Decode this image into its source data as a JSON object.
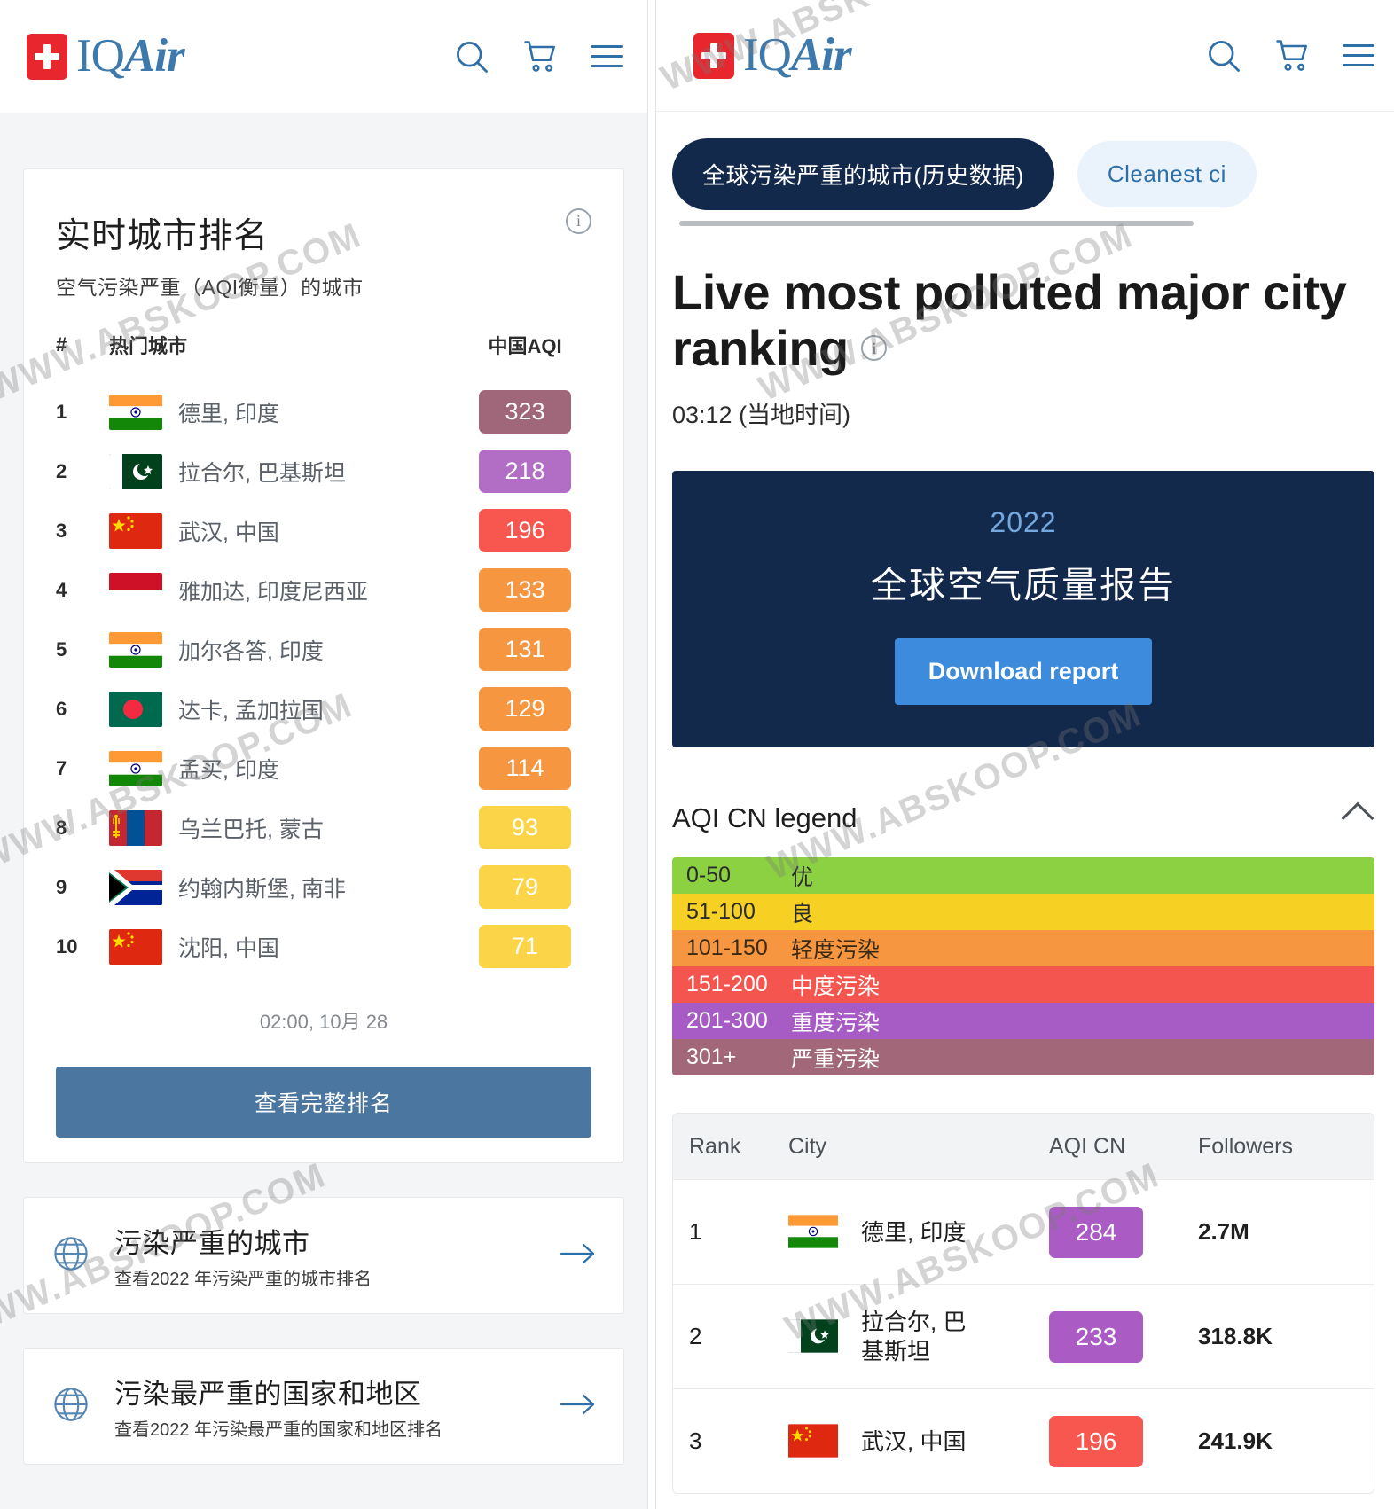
{
  "brand": {
    "name_iq": "IQ",
    "name_air": "Air",
    "accent": "#3e79ab",
    "flag_red": "#e8262d"
  },
  "header": {
    "search_icon": "search-icon",
    "cart_icon": "cart-icon",
    "menu_icon": "hamburger-menu-icon"
  },
  "left": {
    "card": {
      "title": "实时城市排名",
      "subtitle": "空气污染严重（AQI衡量）的城市",
      "info_glyph": "i",
      "columns": {
        "rank": "#",
        "city": "热门城市",
        "aqi": "中国AQI"
      },
      "rows": [
        {
          "rank": "1",
          "city": "德里, 印度",
          "aqi": "323",
          "color": "#a0667a",
          "flag": "in"
        },
        {
          "rank": "2",
          "city": "拉合尔, 巴基斯坦",
          "aqi": "218",
          "color": "#b26dc4",
          "flag": "pk"
        },
        {
          "rank": "3",
          "city": "武汉, 中国",
          "aqi": "196",
          "color": "#f8574f",
          "flag": "cn"
        },
        {
          "rank": "4",
          "city": "雅加达, 印度尼西亚",
          "aqi": "133",
          "color": "#f79640",
          "flag": "id"
        },
        {
          "rank": "5",
          "city": "加尔各答, 印度",
          "aqi": "131",
          "color": "#f79640",
          "flag": "in"
        },
        {
          "rank": "6",
          "city": "达卡, 孟加拉国",
          "aqi": "129",
          "color": "#f79640",
          "flag": "bd"
        },
        {
          "rank": "7",
          "city": "孟买, 印度",
          "aqi": "114",
          "color": "#f79640",
          "flag": "in"
        },
        {
          "rank": "8",
          "city": "乌兰巴托, 蒙古",
          "aqi": "93",
          "color": "#fbd448",
          "flag": "mn"
        },
        {
          "rank": "9",
          "city": "约翰内斯堡, 南非",
          "aqi": "79",
          "color": "#fbd448",
          "flag": "za"
        },
        {
          "rank": "10",
          "city": "沈阳, 中国",
          "aqi": "71",
          "color": "#fbd448",
          "flag": "cn"
        }
      ],
      "timestamp": "02:00, 10月 28",
      "full_ranking_button": "查看完整排名"
    },
    "links": [
      {
        "title": "污染严重的城市",
        "subtitle": "查看2022 年污染严重的城市排名",
        "icon": "globe-icon",
        "arrow": "arrow-right-icon"
      },
      {
        "title": "污染最严重的国家和地区",
        "subtitle": "查看2022 年污染最严重的国家和地区排名",
        "icon": "globe-icon",
        "arrow": "arrow-right-icon"
      }
    ]
  },
  "right": {
    "tabs": [
      {
        "label": "全球污染严重的城市(历史数据)",
        "active": true
      },
      {
        "label": "Cleanest ci",
        "active": false
      }
    ],
    "heading": "Live most polluted major city ranking",
    "heading_info_glyph": "i",
    "local_time": "03:12 (当地时间)",
    "report": {
      "year": "2022",
      "title": "全球空气质量报告",
      "button": "Download report"
    },
    "legend": {
      "title": "AQI CN legend",
      "collapse_icon": "chevron-up-icon",
      "rows": [
        {
          "range": "0-50",
          "label": "优",
          "bg": "#8bd142",
          "fg": "#2b2b2b"
        },
        {
          "range": "51-100",
          "label": "良",
          "bg": "#f7d024",
          "fg": "#2b2b2b"
        },
        {
          "range": "101-150",
          "label": "轻度污染",
          "bg": "#f79640",
          "fg": "#3a2a14"
        },
        {
          "range": "151-200",
          "label": "中度污染",
          "bg": "#f4564f",
          "fg": "#ffffff"
        },
        {
          "range": "201-300",
          "label": "重度污染",
          "bg": "#a75bc4",
          "fg": "#ffffff"
        },
        {
          "range": "301+",
          "label": "严重污染",
          "bg": "#a2687a",
          "fg": "#ffffff"
        }
      ]
    },
    "table": {
      "columns": {
        "rank": "Rank",
        "city": "City",
        "aqi": "AQI CN",
        "followers": "Followers"
      },
      "rows": [
        {
          "rank": "1",
          "city": "德里, 印度",
          "aqi": "284",
          "color": "#ab5cc4",
          "followers": "2.7M",
          "flag": "in"
        },
        {
          "rank": "2",
          "city": "拉合尔, 巴\n基斯坦",
          "aqi": "233",
          "color": "#ab5cc4",
          "followers": "318.8K",
          "flag": "pk"
        },
        {
          "rank": "3",
          "city": "武汉, 中国",
          "aqi": "196",
          "color": "#f8574f",
          "followers": "241.9K",
          "flag": "cn"
        }
      ]
    }
  },
  "watermark": {
    "text": "WWW.ABSKOOP.COM"
  }
}
